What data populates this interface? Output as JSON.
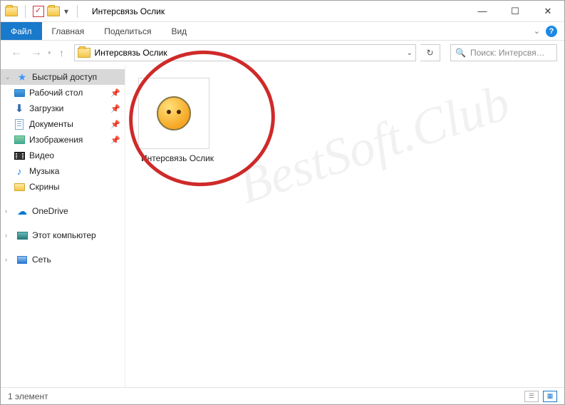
{
  "window": {
    "title": "Интерсвязь Ослик",
    "qat_dropdown": "▾"
  },
  "ribbon": {
    "file": "Файл",
    "tabs": [
      "Главная",
      "Поделиться",
      "Вид"
    ]
  },
  "nav": {
    "breadcrumb": "Интерсвязь Ослик",
    "search_placeholder": "Поиск: Интерсвя…"
  },
  "sidebar": {
    "quick_access": "Быстрый доступ",
    "items": [
      {
        "icon": "desktop",
        "label": "Рабочий стол",
        "pinned": true
      },
      {
        "icon": "download",
        "label": "Загрузки",
        "pinned": true
      },
      {
        "icon": "docs",
        "label": "Документы",
        "pinned": true
      },
      {
        "icon": "images",
        "label": "Изображения",
        "pinned": true
      },
      {
        "icon": "video",
        "label": "Видео",
        "pinned": false
      },
      {
        "icon": "music",
        "label": "Музыка",
        "pinned": false
      },
      {
        "icon": "folder",
        "label": "Скрины",
        "pinned": false
      }
    ],
    "onedrive": "OneDrive",
    "this_pc": "Этот компьютер",
    "network": "Сеть"
  },
  "content": {
    "files": [
      {
        "label": "Интерсвязь Ослик"
      }
    ]
  },
  "status": {
    "count": "1 элемент"
  },
  "watermark": "BestSoft.Club"
}
